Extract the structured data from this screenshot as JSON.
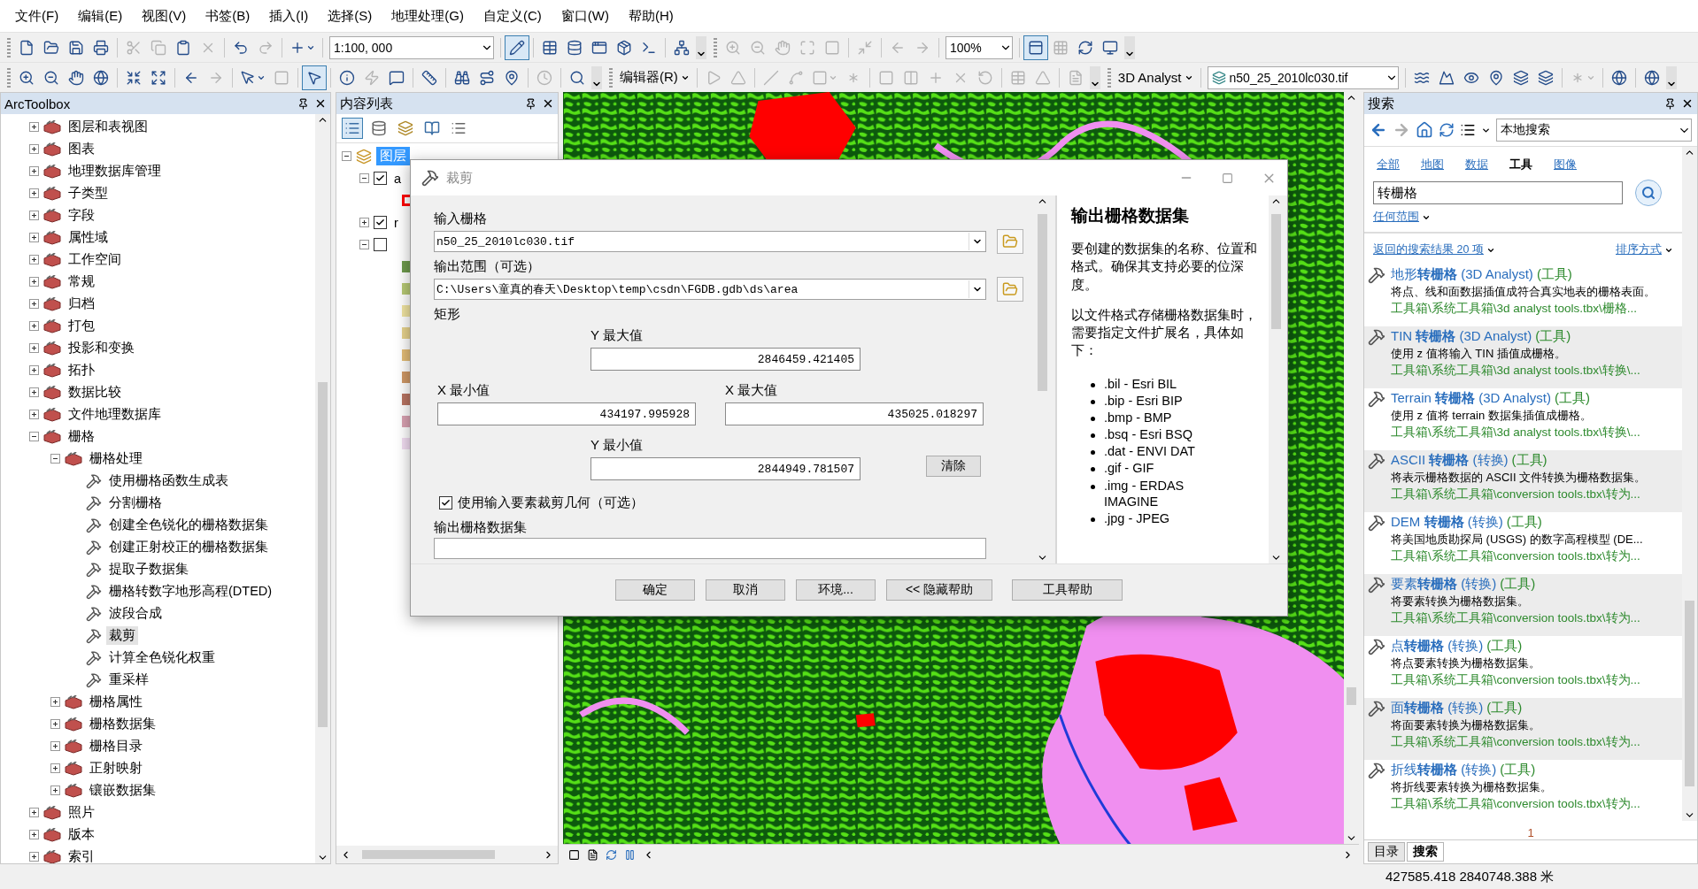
{
  "menu": [
    "文件(F)",
    "编辑(E)",
    "视图(V)",
    "书签(B)",
    "插入(I)",
    "选择(S)",
    "地理处理(G)",
    "自定义(C)",
    "窗口(W)",
    "帮助(H)"
  ],
  "toolbars": [
    [
      [
        {
          "kind": "buttons",
          "buttons": [
            {
              "disabled": false,
              "pressed": false
            },
            {
              "disabled": false,
              "pressed": false
            },
            {
              "disabled": false,
              "pressed": false
            },
            {
              "disabled": false,
              "pressed": false
            }
          ]
        },
        {
          "kind": "buttons",
          "buttons": [
            {
              "disabled": true,
              "pressed": false
            },
            {
              "disabled": true,
              "pressed": false
            },
            {
              "disabled": false,
              "pressed": false
            },
            {
              "disabled": true,
              "pressed": false
            }
          ]
        },
        {
          "kind": "buttons",
          "buttons": [
            {
              "disabled": false,
              "pressed": false
            },
            {
              "disabled": true,
              "pressed": false
            }
          ]
        },
        {
          "kind": "buttons",
          "buttons": [
            {
              "disabled": false,
              "pressed": false
            }
          ]
        },
        {
          "kind": "combo",
          "value": "1:100, 000"
        },
        {
          "kind": "buttons",
          "buttons": [
            {
              "disabled": false,
              "pressed": true
            }
          ]
        },
        {
          "kind": "buttons",
          "buttons": [
            {
              "disabled": false,
              "pressed": false
            },
            {
              "disabled": false,
              "pressed": false
            },
            {
              "disabled": false,
              "pressed": false
            },
            {
              "disabled": false,
              "pressed": false
            },
            {
              "disabled": false,
              "pressed": false
            }
          ]
        },
        {
          "kind": "buttons",
          "buttons": [
            {
              "disabled": false,
              "pressed": false
            }
          ]
        }
      ],
      [
        {
          "kind": "buttons",
          "buttons": [
            {
              "disabled": true,
              "pressed": false
            },
            {
              "disabled": true,
              "pressed": false
            },
            {
              "disabled": true,
              "pressed": false
            },
            {
              "disabled": true,
              "pressed": false
            },
            {
              "disabled": true,
              "pressed": false
            }
          ]
        },
        {
          "kind": "buttons",
          "buttons": [
            {
              "disabled": true,
              "pressed": false
            }
          ]
        },
        {
          "kind": "buttons",
          "buttons": [
            {
              "disabled": true,
              "pressed": false
            },
            {
              "disabled": true,
              "pressed": false
            }
          ]
        },
        {
          "kind": "combo",
          "value": "100%"
        },
        {
          "kind": "buttons",
          "buttons": [
            {
              "disabled": false,
              "pressed": true
            },
            {
              "disabled": true,
              "pressed": false
            },
            {
              "disabled": false,
              "pressed": false
            },
            {
              "disabled": false,
              "pressed": false
            }
          ]
        }
      ]
    ],
    [
      [
        {
          "kind": "buttons",
          "buttons": [
            {
              "disabled": false,
              "pressed": false
            },
            {
              "disabled": false,
              "pressed": false
            },
            {
              "disabled": false,
              "pressed": false
            },
            {
              "disabled": false,
              "pressed": false
            }
          ]
        },
        {
          "kind": "buttons",
          "buttons": [
            {
              "disabled": false,
              "pressed": false
            },
            {
              "disabled": false,
              "pressed": false
            }
          ]
        },
        {
          "kind": "buttons",
          "buttons": [
            {
              "disabled": false,
              "pressed": false
            },
            {
              "disabled": true,
              "pressed": false
            }
          ]
        },
        {
          "kind": "buttons",
          "buttons": [
            {
              "disabled": false,
              "pressed": false
            },
            {
              "disabled": true,
              "pressed": false
            }
          ]
        },
        {
          "kind": "buttons",
          "buttons": [
            {
              "disabled": false,
              "pressed": true
            }
          ]
        },
        {
          "kind": "buttons",
          "buttons": [
            {
              "disabled": false,
              "pressed": false
            },
            {
              "disabled": true,
              "pressed": false
            },
            {
              "disabled": false,
              "pressed": false
            }
          ]
        },
        {
          "kind": "buttons",
          "buttons": [
            {
              "disabled": false,
              "pressed": false
            }
          ]
        },
        {
          "kind": "buttons",
          "buttons": [
            {
              "disabled": false,
              "pressed": false
            },
            {
              "disabled": false,
              "pressed": false
            },
            {
              "disabled": false,
              "pressed": false
            }
          ]
        },
        {
          "kind": "buttons",
          "buttons": [
            {
              "disabled": true,
              "pressed": false
            }
          ]
        },
        {
          "kind": "buttons",
          "buttons": [
            {
              "disabled": false,
              "pressed": false
            }
          ]
        }
      ],
      [
        {
          "kind": "menu",
          "label": "编辑器(R)"
        },
        {
          "kind": "buttons",
          "buttons": [
            {
              "disabled": true,
              "pressed": false
            },
            {
              "disabled": true,
              "pressed": false
            }
          ]
        },
        {
          "kind": "buttons",
          "buttons": [
            {
              "disabled": true,
              "pressed": false
            },
            {
              "disabled": true,
              "pressed": false
            },
            {
              "disabled": true,
              "pressed": false
            },
            {
              "disabled": true,
              "pressed": false
            }
          ]
        },
        {
          "kind": "buttons",
          "buttons": [
            {
              "disabled": true,
              "pressed": false
            },
            {
              "disabled": true,
              "pressed": false
            },
            {
              "disabled": true,
              "pressed": false
            },
            {
              "disabled": true,
              "pressed": false
            },
            {
              "disabled": true,
              "pressed": false
            }
          ]
        },
        {
          "kind": "buttons",
          "buttons": [
            {
              "disabled": true,
              "pressed": false
            },
            {
              "disabled": true,
              "pressed": false
            }
          ]
        },
        {
          "kind": "buttons",
          "buttons": [
            {
              "disabled": true,
              "pressed": false
            }
          ]
        }
      ],
      [
        {
          "kind": "menu",
          "label": "3D Analyst"
        },
        {
          "kind": "layer",
          "value": "n50_25_2010lc030.tif"
        },
        {
          "kind": "buttons",
          "buttons": [
            {
              "disabled": false,
              "pressed": false
            },
            {
              "disabled": false,
              "pressed": false
            },
            {
              "disabled": false,
              "pressed": false
            },
            {
              "disabled": false,
              "pressed": false
            },
            {
              "disabled": false,
              "pressed": false
            },
            {
              "disabled": false,
              "pressed": false
            }
          ]
        },
        {
          "kind": "buttons",
          "buttons": [
            {
              "disabled": true,
              "pressed": false
            }
          ]
        },
        {
          "kind": "buttons",
          "buttons": [
            {
              "disabled": false,
              "pressed": false
            }
          ]
        },
        {
          "kind": "buttons",
          "buttons": [
            {
              "disabled": false,
              "pressed": false
            }
          ]
        }
      ]
    ]
  ],
  "arctoolbox": {
    "title": "ArcToolbox",
    "items": [
      {
        "label": "图层和表视图",
        "kind": "toolset",
        "expanded": false,
        "selected": false
      },
      {
        "label": "图表",
        "kind": "toolset",
        "expanded": false,
        "selected": false
      },
      {
        "label": "地理数据库管理",
        "kind": "toolset",
        "expanded": false,
        "selected": false
      },
      {
        "label": "子类型",
        "kind": "toolset",
        "expanded": false,
        "selected": false
      },
      {
        "label": "字段",
        "kind": "toolset",
        "expanded": false,
        "selected": false
      },
      {
        "label": "属性域",
        "kind": "toolset",
        "expanded": false,
        "selected": false
      },
      {
        "label": "工作空间",
        "kind": "toolset",
        "expanded": false,
        "selected": false
      },
      {
        "label": "常规",
        "kind": "toolset",
        "expanded": false,
        "selected": false
      },
      {
        "label": "归档",
        "kind": "toolset",
        "expanded": false,
        "selected": false
      },
      {
        "label": "打包",
        "kind": "toolset",
        "expanded": false,
        "selected": false
      },
      {
        "label": "投影和变换",
        "kind": "toolset",
        "expanded": false,
        "selected": false
      },
      {
        "label": "拓扑",
        "kind": "toolset",
        "expanded": false,
        "selected": false
      },
      {
        "label": "数据比较",
        "kind": "toolset",
        "expanded": false,
        "selected": false
      },
      {
        "label": "文件地理数据库",
        "kind": "toolset",
        "expanded": false,
        "selected": false
      },
      {
        "label": "栅格",
        "kind": "toolset",
        "expanded": true,
        "selected": false,
        "children": [
          {
            "label": "栅格处理",
            "kind": "toolset",
            "expanded": true,
            "selected": false,
            "children": [
              {
                "label": "使用栅格函数生成表",
                "kind": "tool",
                "selected": false
              },
              {
                "label": "分割栅格",
                "kind": "tool",
                "selected": false
              },
              {
                "label": "创建全色锐化的栅格数据集",
                "kind": "tool",
                "selected": false
              },
              {
                "label": "创建正射校正的栅格数据集",
                "kind": "tool",
                "selected": false
              },
              {
                "label": "提取子数据集",
                "kind": "tool",
                "selected": false
              },
              {
                "label": "栅格转数字地形高程(DTED)",
                "kind": "tool",
                "selected": false
              },
              {
                "label": "波段合成",
                "kind": "tool",
                "selected": false
              },
              {
                "label": "裁剪",
                "kind": "tool",
                "selected": true
              },
              {
                "label": "计算全色锐化权重",
                "kind": "tool",
                "selected": false
              },
              {
                "label": "重采样",
                "kind": "tool",
                "selected": false
              }
            ]
          },
          {
            "label": "栅格属性",
            "kind": "toolset",
            "expanded": false,
            "selected": false
          },
          {
            "label": "栅格数据集",
            "kind": "toolset",
            "expanded": false,
            "selected": false
          },
          {
            "label": "栅格目录",
            "kind": "toolset",
            "expanded": false,
            "selected": false
          },
          {
            "label": "正射映射",
            "kind": "toolset",
            "expanded": false,
            "selected": false
          },
          {
            "label": "镶嵌数据集",
            "kind": "toolset",
            "expanded": false,
            "selected": false
          }
        ]
      },
      {
        "label": "照片",
        "kind": "toolset",
        "expanded": false,
        "selected": false
      },
      {
        "label": "版本",
        "kind": "toolset",
        "expanded": false,
        "selected": false
      },
      {
        "label": "索引",
        "kind": "toolset",
        "expanded": false,
        "selected": false
      }
    ]
  },
  "content_list": {
    "title": "内容列表",
    "root": {
      "label": "图层",
      "selected": true,
      "expanded": true
    },
    "layers": [
      {
        "label": "a",
        "checked": true,
        "expanded": true,
        "legend": [
          {
            "kind": "outline",
            "color": "#ff0000"
          }
        ]
      },
      {
        "label": "r",
        "checked": true,
        "expanded": false
      },
      {
        "checked": false,
        "expanded": true,
        "legend": [
          {
            "kind": "fill",
            "color": "#6e9a4c"
          },
          {
            "kind": "fill",
            "color": "#b6c874"
          },
          {
            "kind": "fill",
            "color": "#efe3a0"
          },
          {
            "kind": "fill",
            "color": "#e6d28c"
          },
          {
            "kind": "fill",
            "color": "#e3bc76"
          },
          {
            "kind": "fill",
            "color": "#cf9866"
          },
          {
            "kind": "fill",
            "color": "#b87462"
          },
          {
            "kind": "fill",
            "color": "#d9a2b2"
          },
          {
            "kind": "fill",
            "color": "#f1dcf1"
          }
        ]
      }
    ]
  },
  "dialog": {
    "title": "裁剪",
    "input_raster": {
      "label": "输入栅格",
      "value": "n50_25_2010lc030.tif"
    },
    "output_extent": {
      "label": "输出范围（可选）",
      "value": "C:\\Users\\童真的春天\\Desktop\\temp\\csdn\\FGDB.gdb\\ds\\area"
    },
    "rectangle": {
      "label": "矩形",
      "y_max": {
        "label": "Y 最大值",
        "value": "2846459.421405"
      },
      "x_min": {
        "label": "X 最小值",
        "value": "434197.995928"
      },
      "x_max": {
        "label": "X 最大值",
        "value": "435025.018297"
      },
      "y_min": {
        "label": "Y 最小值",
        "value": "2844949.781507"
      },
      "clear": "清除"
    },
    "use_clip_geometry": {
      "label": "使用输入要素裁剪几何（可选）",
      "checked": true
    },
    "output_raster": {
      "label": "输出栅格数据集"
    },
    "help": {
      "title": "输出栅格数据集",
      "paragraphs": [
        "要创建的数据集的名称、位置和格式。确保其支持必要的位深度。",
        "以文件格式存储栅格数据集时，需要指定文件扩展名，具体如下："
      ],
      "formats": [
        ".bil - Esri BIL",
        ".bip - Esri BIP",
        ".bmp - BMP",
        ".bsq - Esri BSQ",
        ".dat - ENVI DAT",
        ".gif - GIF",
        ".img - ERDAS IMAGINE",
        ".jpg - JPEG"
      ]
    },
    "buttons": [
      "确定",
      "取消",
      "环境...",
      "<< 隐藏帮助",
      "工具帮助"
    ]
  },
  "search": {
    "title": "搜索",
    "scope": "本地搜索",
    "tabs": [
      {
        "label": "全部",
        "selected": false
      },
      {
        "label": "地图",
        "selected": false
      },
      {
        "label": "数据",
        "selected": false
      },
      {
        "label": "工具",
        "selected": true
      },
      {
        "label": "图像",
        "selected": false
      }
    ],
    "query": "转栅格",
    "range": "任何范围",
    "count": "返回的搜索结果 20 项",
    "sort": "排序方式",
    "results": [
      {
        "name": "地形**转栅格** (3D Analyst)",
        "tag": "(工具)",
        "description": "将点、线和面数据插值成符合真实地表的栅格表面。",
        "path": "工具箱\\系统工具箱\\3d analyst tools.tbx\\栅格..."
      },
      {
        "name": "TIN **转栅格** (3D Analyst)",
        "tag": "(工具)",
        "description": "使用 z 值将输入 TIN 插值成栅格。",
        "path": "工具箱\\系统工具箱\\3d analyst tools.tbx\\转换\\..."
      },
      {
        "name": "Terrain **转栅格** (3D Analyst)",
        "tag": "(工具)",
        "description": "使用 z 值将 terrain 数据集插值成栅格。",
        "path": "工具箱\\系统工具箱\\3d analyst tools.tbx\\转换\\..."
      },
      {
        "name": "ASCII **转栅格** (转换)",
        "tag": "(工具)",
        "description": "将表示栅格数据的 ASCII 文件转换为栅格数据集。",
        "path": "工具箱\\系统工具箱\\conversion tools.tbx\\转为..."
      },
      {
        "name": "DEM **转栅格** (转换)",
        "tag": "(工具)",
        "description": "将美国地质勘探局 (USGS) 的数字高程模型 (DE...",
        "path": "工具箱\\系统工具箱\\conversion tools.tbx\\转为..."
      },
      {
        "name": "要素**转栅格** (转换)",
        "tag": "(工具)",
        "description": "将要素转换为栅格数据集。",
        "path": "工具箱\\系统工具箱\\conversion tools.tbx\\转为..."
      },
      {
        "name": "点**转栅格** (转换)",
        "tag": "(工具)",
        "description": "将点要素转换为栅格数据集。",
        "path": "工具箱\\系统工具箱\\conversion tools.tbx\\转为..."
      },
      {
        "name": "面**转栅格** (转换)",
        "tag": "(工具)",
        "description": "将面要素转换为栅格数据集。",
        "path": "工具箱\\系统工具箱\\conversion tools.tbx\\转为..."
      },
      {
        "name": "折线**转栅格** (转换)",
        "tag": "(工具)",
        "description": "将折线要素转换为栅格数据集。",
        "path": "工具箱\\系统工具箱\\conversion tools.tbx\\转为..."
      }
    ],
    "page": "1",
    "bottom_tabs": [
      {
        "label": "目录",
        "selected": false
      },
      {
        "label": "搜索",
        "selected": true
      }
    ]
  },
  "status_bar": {
    "coordinates": "427585.418  2840748.388 米"
  }
}
